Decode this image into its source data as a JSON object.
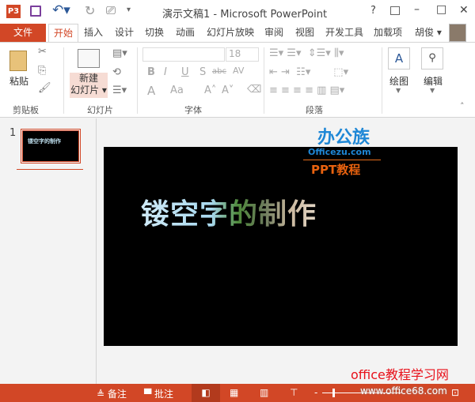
{
  "titlebar": {
    "title": "演示文稿1 - Microsoft PowerPoint",
    "app_icon": "P3",
    "help": "?",
    "ribbon_display": "ribbon-display-icon",
    "minimize": "–",
    "maximize": "□",
    "close": "✕"
  },
  "tabs": {
    "file": "文件",
    "items": [
      "开始",
      "插入",
      "设计",
      "切换",
      "动画",
      "幻灯片放映",
      "审阅",
      "视图",
      "开发工具",
      "加载项"
    ],
    "user": "胡俊 ▾"
  },
  "ribbon": {
    "clipboard": {
      "paste": "粘贴",
      "label": "剪贴板"
    },
    "slides": {
      "new_slide_1": "新建",
      "new_slide_2": "幻灯片 ▾",
      "label": "幻灯片"
    },
    "font": {
      "font_name": "",
      "font_size": "18",
      "label": "字体",
      "bold": "B",
      "italic": "I",
      "underline": "U",
      "shadow": "S",
      "strike": "abc",
      "spacing": "AV",
      "color": "A",
      "case": "Aa",
      "grow": "A˄",
      "shrink": "A˅"
    },
    "paragraph": {
      "label": "段落"
    },
    "drawing": {
      "label": "绘图"
    },
    "editing": {
      "label": "编辑"
    }
  },
  "thumbs": [
    {
      "number": "1",
      "text": "镂空字的制作"
    }
  ],
  "slide": {
    "title": "镂空字的制作"
  },
  "watermark": {
    "logo": "办公族",
    "site": "Officezu.com",
    "subtitle": "PPT教程",
    "footer": "office教程学习网",
    "footer_url": "www.office68.com"
  },
  "status": {
    "notes": "备注",
    "comments": "批注"
  },
  "colors": {
    "accent": "#d24726",
    "slide_bg": "#000000"
  }
}
